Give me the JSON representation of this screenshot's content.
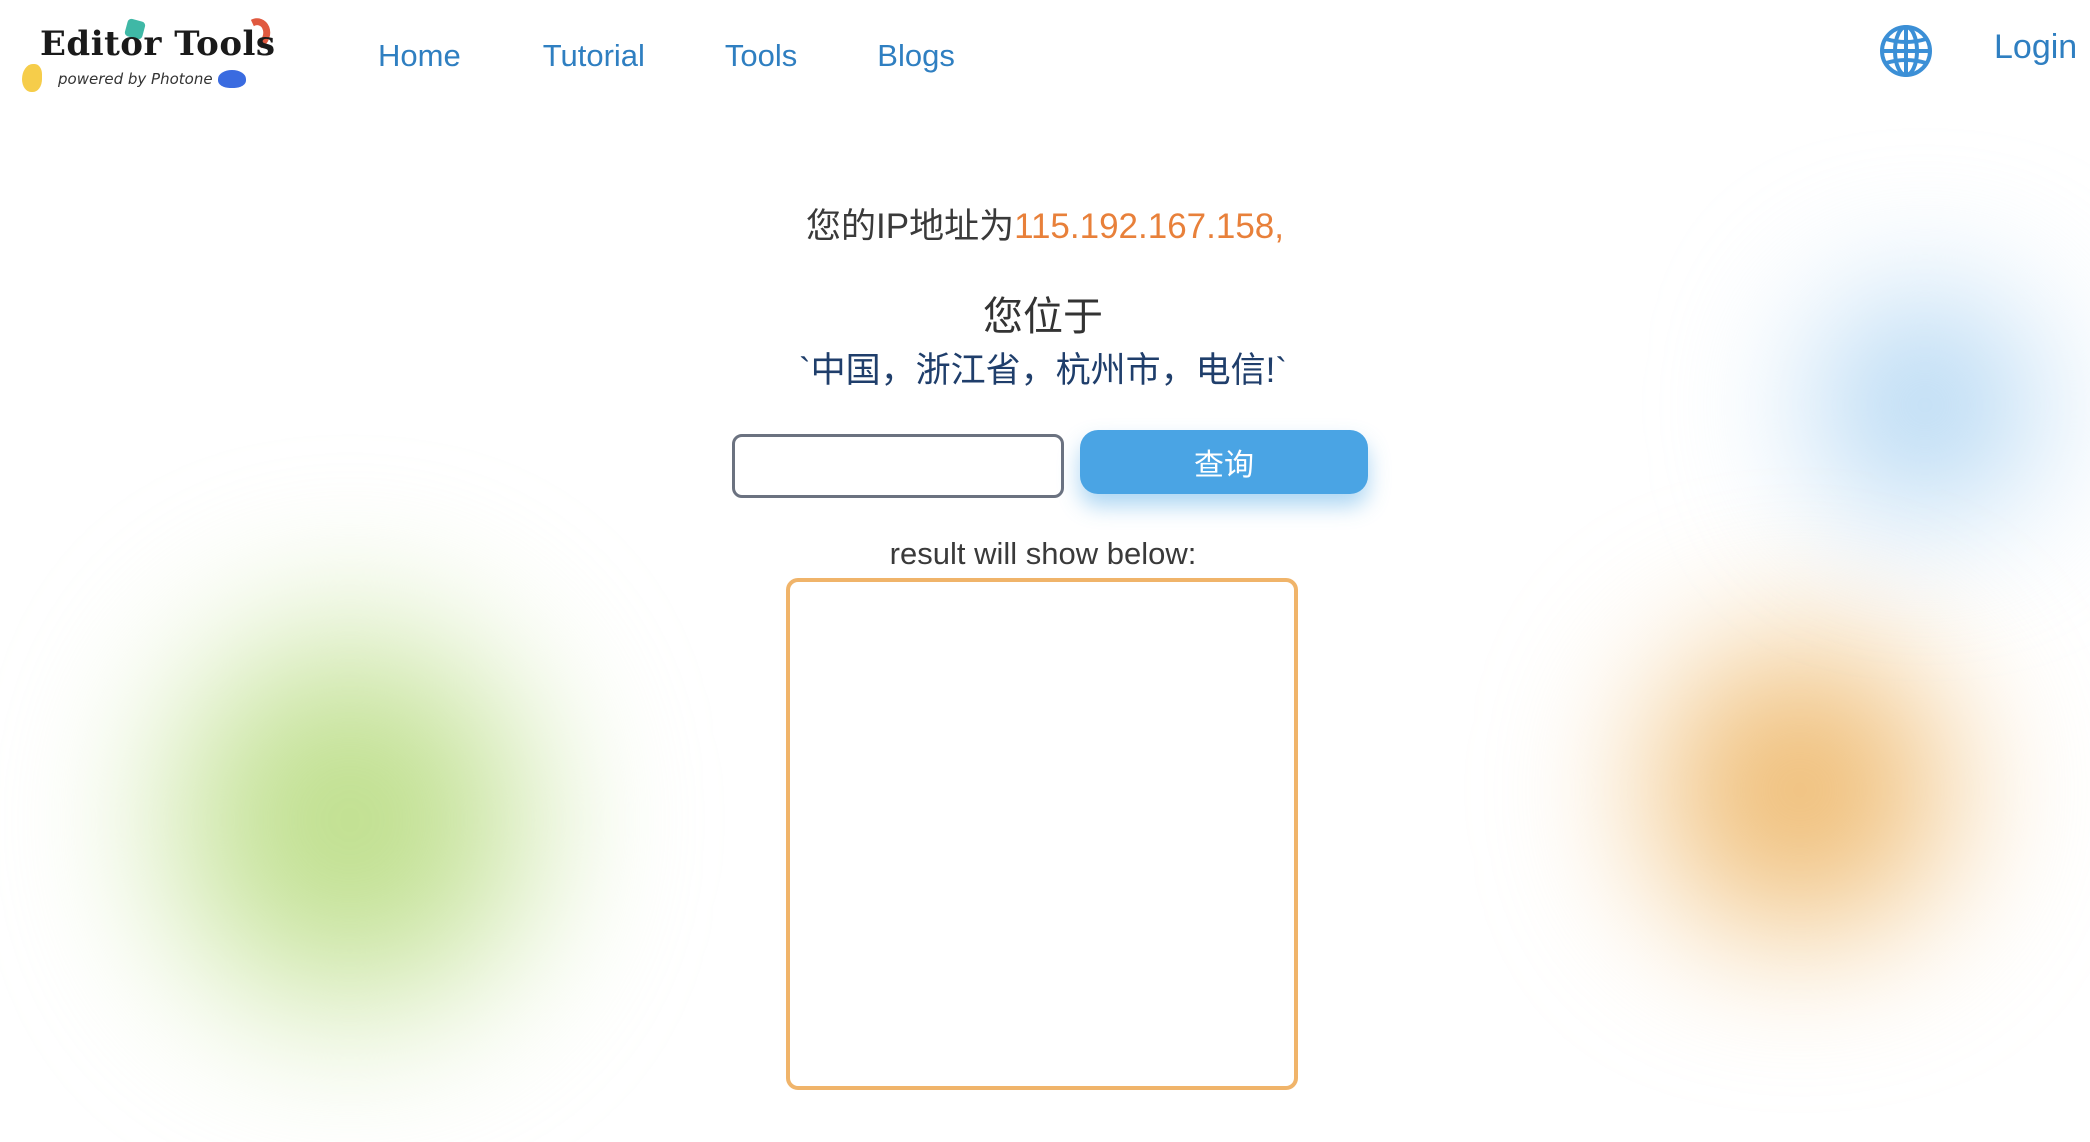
{
  "brand": {
    "title": "Editor Tools",
    "subtitle": "powered by Photone"
  },
  "nav": {
    "items": [
      {
        "label": "Home"
      },
      {
        "label": "Tutorial"
      },
      {
        "label": "Tools"
      },
      {
        "label": "Blogs"
      }
    ],
    "language_icon": "globe-icon",
    "login_label": "Login"
  },
  "ip_info": {
    "prefix": "您的IP地址为",
    "ip": "115.192.167.158,",
    "located_label": "您位于",
    "location": "`中国，浙江省，杭州市，电信!`"
  },
  "query": {
    "input_value": "",
    "button_label": "查询"
  },
  "result": {
    "label": "result will show below:",
    "value": ""
  },
  "colors": {
    "link": "#2f7fc1",
    "ip_highlight": "#e8803a",
    "button": "#4aa4e4",
    "result_border": "#f0b46a"
  }
}
